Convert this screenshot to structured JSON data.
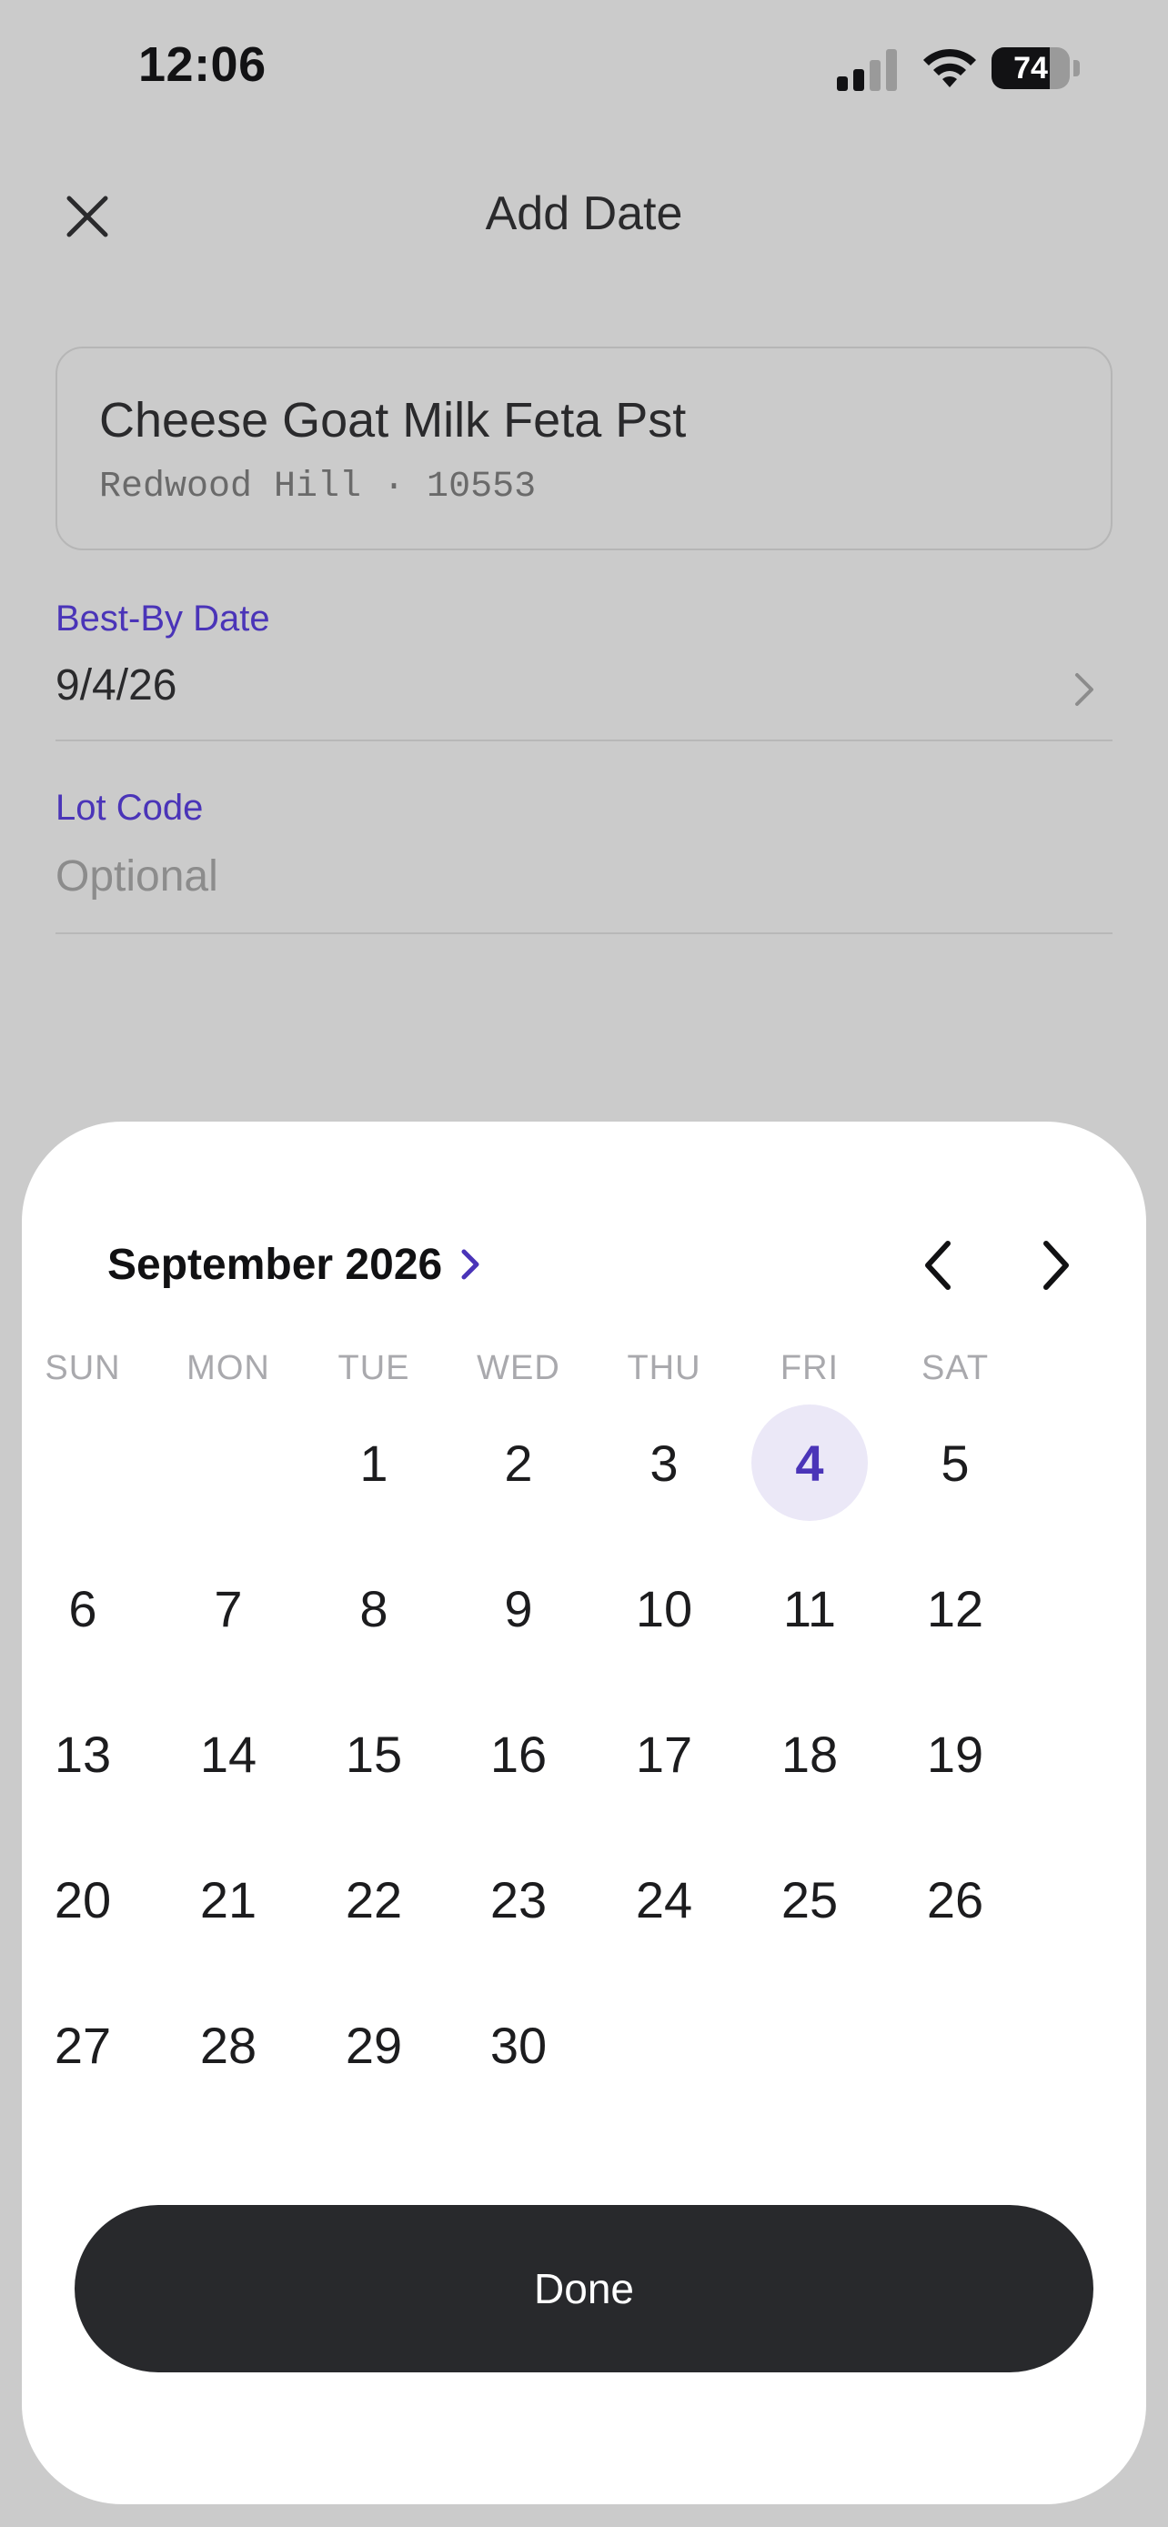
{
  "status_bar": {
    "time": "12:06",
    "battery_percent": "74",
    "battery_level": 0.74,
    "icons": [
      "signal-icon",
      "wifi-icon",
      "battery-icon"
    ]
  },
  "header": {
    "title": "Add Date",
    "close_icon": "close-icon"
  },
  "product": {
    "name": "Cheese Goat Milk Feta Pst",
    "meta": "Redwood Hill · 10553"
  },
  "fields": {
    "best_by": {
      "label": "Best-By Date",
      "value": "9/4/26"
    },
    "lot_code": {
      "label": "Lot Code",
      "placeholder": "Optional"
    }
  },
  "calendar": {
    "month_year": "September 2026",
    "weekdays": [
      "SUN",
      "MON",
      "TUE",
      "WED",
      "THU",
      "FRI",
      "SAT"
    ],
    "first_weekday_index": 2,
    "days_in_month": 30,
    "selected_day": 4,
    "done_label": "Done"
  },
  "colors": {
    "accent": "#4a34b8",
    "selected_bg": "#ebe8f7",
    "done_bg": "#28292c",
    "overlay": "#cbcbcb"
  }
}
